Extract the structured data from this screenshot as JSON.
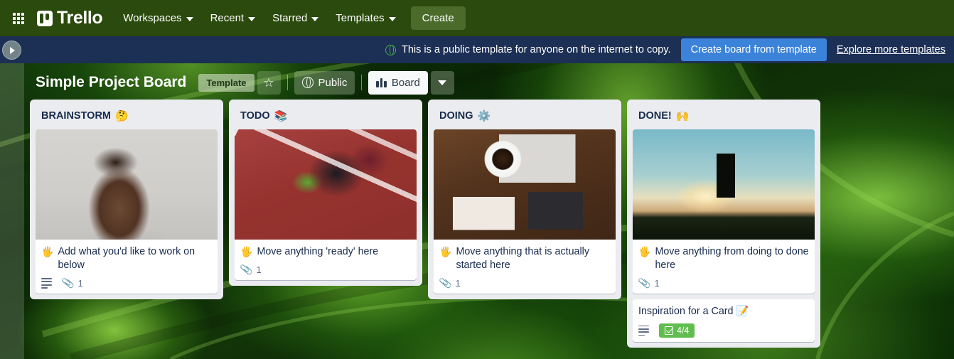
{
  "topnav": {
    "apps_icon": "grid-apps-icon",
    "brand": "Trello",
    "items": [
      {
        "label": "Workspaces",
        "icon": "chevron-down-icon"
      },
      {
        "label": "Recent",
        "icon": "chevron-down-icon"
      },
      {
        "label": "Starred",
        "icon": "chevron-down-icon"
      },
      {
        "label": "Templates",
        "icon": "chevron-down-icon"
      }
    ],
    "create_label": "Create",
    "bg_color": "#2b4a0d"
  },
  "banner": {
    "icon": "globe-public-icon",
    "message": "This is a public template for anyone on the internet to copy.",
    "cta_label": "Create board from template",
    "link_label": "Explore more templates",
    "bg_color": "#1c2f54",
    "cta_color": "#3b82d9"
  },
  "sidebar": {
    "toggle_icon": "chevron-right-icon"
  },
  "board_header": {
    "title": "Simple Project Board",
    "template_badge": "Template",
    "star_icon": "star-outline-icon",
    "visibility": {
      "label": "Public",
      "icon": "globe-icon"
    },
    "view": {
      "label": "Board",
      "icon": "board-columns-icon"
    },
    "view_caret_icon": "chevron-down-icon"
  },
  "lists": [
    {
      "title": "BRAINSTORM",
      "emoji": "🤔",
      "cover": "cover-brainstorm",
      "cover_alt": "person looking upward thinking",
      "cards": [
        {
          "emoji": "🖐️",
          "text": "Add what you'd like to work on below",
          "has_description": true,
          "attachments": "1",
          "checklist": null
        }
      ]
    },
    {
      "title": "TODO",
      "emoji": "📚",
      "cover": "cover-todo",
      "cover_alt": "runner in starting blocks on red track",
      "cards": [
        {
          "emoji": "🖐️",
          "text": "Move anything 'ready' here",
          "has_description": false,
          "attachments": "1",
          "checklist": null
        }
      ]
    },
    {
      "title": "DOING",
      "emoji": "⚙️",
      "cover": "cover-doing",
      "cover_alt": "desk with coffee laptop and notebook",
      "cards": [
        {
          "emoji": "🖐️",
          "text": "Move anything that is actually started here",
          "has_description": false,
          "attachments": "1",
          "checklist": null
        }
      ]
    },
    {
      "title": "DONE!",
      "emoji": "🙌",
      "cover": "cover-done",
      "cover_alt": "person jumping at sunset silhouette",
      "cards": [
        {
          "emoji": "🖐️",
          "text": "Move anything from doing to done here",
          "has_description": false,
          "attachments": "1",
          "checklist": null
        },
        {
          "emoji": "",
          "text": "Inspiration for a Card 📝",
          "has_description": true,
          "attachments": null,
          "checklist": "4/4",
          "checklist_color": "#61bd4f"
        }
      ]
    }
  ]
}
